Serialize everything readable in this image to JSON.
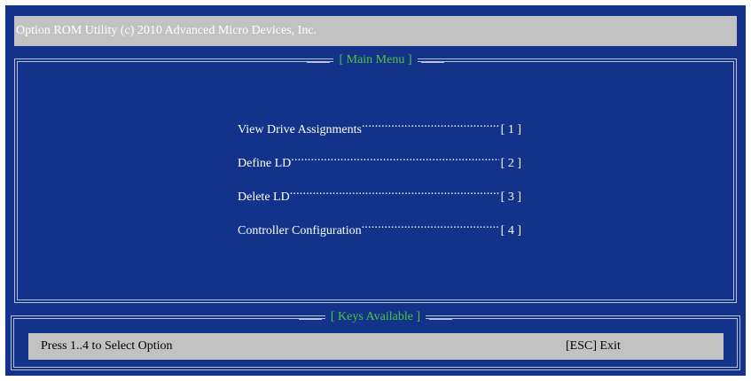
{
  "title_bar": {
    "text": "Option ROM Utility (c) 2010 Advanced Micro Devices, Inc."
  },
  "main_menu": {
    "title": "[ Main Menu ]",
    "items": [
      {
        "label": "View Drive Assignments",
        "key": "[ 1 ]"
      },
      {
        "label": "Define LD",
        "key": "[ 2 ]"
      },
      {
        "label": "Delete LD",
        "key": "[ 3 ]"
      },
      {
        "label": "Controller Configuration",
        "key": "[ 4 ]"
      }
    ]
  },
  "keys_panel": {
    "title": "[ Keys Available ]",
    "hint": "Press 1..4 to Select Option",
    "exit": "[ESC] Exit"
  },
  "colors": {
    "background": "#13338a",
    "title_bar": "#c2c2c2",
    "frame_title": "#4fc43d",
    "frame_border": "#b9c2da",
    "menu_text": "#ffffff"
  }
}
